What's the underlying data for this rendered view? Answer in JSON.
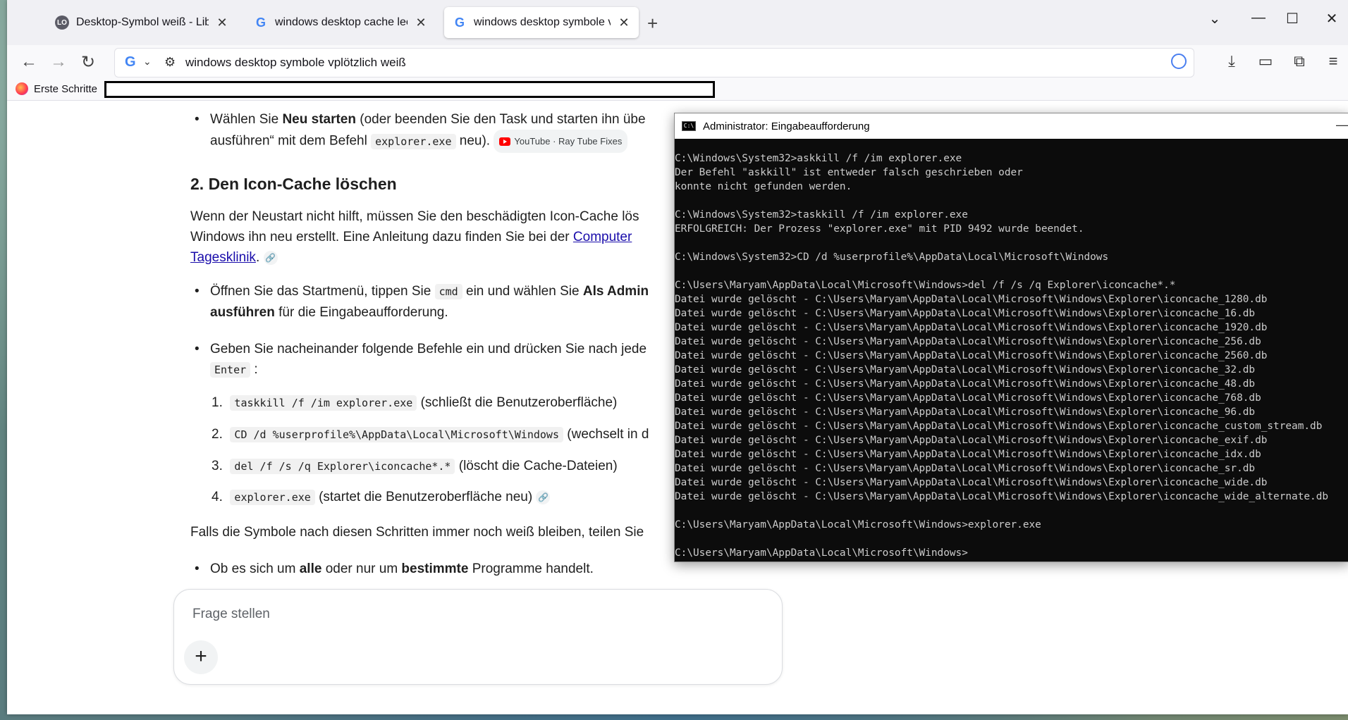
{
  "tabs": [
    {
      "label": "Desktop-Symbol weiß - LibreOf",
      "favicon": "libreoffice-icon"
    },
    {
      "label": "windows desktop cache leeren ·",
      "favicon": "google-icon"
    },
    {
      "label": "windows desktop symbole vplöt",
      "favicon": "google-icon",
      "active": true
    }
  ],
  "address": {
    "url": "windows desktop symbole vplötzlich weiß"
  },
  "bookmarks": {
    "first": "Erste Schritte"
  },
  "article": {
    "b1_pre": "Wählen Sie ",
    "b1_bold": "Neu starten",
    "b1_post": " (oder beenden Sie den Task und starten ihn übe",
    "b1_line2_pre": "ausführen“ mit dem Befehl ",
    "b1_code": "explorer.exe",
    "b1_line2_post": " neu).",
    "chip": "YouTube · Ray Tube Fixes",
    "h2": "2. Den Icon-Cache löschen",
    "p1_l1": "Wenn der Neustart nicht hilft, müssen Sie den beschädigten Icon-Cache lös",
    "p1_l2_pre": "Windows ihn neu erstellt. Eine Anleitung dazu finden Sie bei der ",
    "p1_link1": "Computer",
    "p1_link2": "Tagesklinik",
    "p1_end": ".",
    "b2_pre": "Öffnen Sie das Startmenü, tippen Sie ",
    "b2_code": "cmd",
    "b2_mid": " ein und wählen Sie ",
    "b2_bold1": "Als Admin",
    "b2_bold2": "ausführen",
    "b2_post": " für die Eingabeaufforderung.",
    "b3_l1": "Geben Sie nacheinander folgende Befehle ein und drücken Sie nach jede",
    "b3_code": "Enter",
    "b3_colon": " :",
    "steps": [
      {
        "num": "1.",
        "code": "taskkill /f /im explorer.exe",
        "text": " (schließt die Benutzeroberfläche)"
      },
      {
        "num": "2.",
        "code": "CD /d %userprofile%\\AppData\\Local\\Microsoft\\Windows",
        "text": " (wechselt in d"
      },
      {
        "num": "3.",
        "code": "del /f /s /q Explorer\\iconcache*.*",
        "text": " (löscht die Cache-Dateien)"
      },
      {
        "num": "4.",
        "code": "explorer.exe",
        "text": " (startet die Benutzeroberfläche neu)"
      }
    ],
    "p2": "Falls die Symbole nach diesen Schritten immer noch weiß bleiben, teilen Sie",
    "b4_pre": "Ob es sich um ",
    "b4_bold1": "alle",
    "b4_mid": " oder nur um ",
    "b4_bold2": "bestimmte",
    "b4_post": " Programme handelt."
  },
  "ask": {
    "placeholder": "Frage stellen",
    "plus": "+"
  },
  "cmd": {
    "title": "Administrator: Eingabeaufforderung",
    "lines": [
      "C:\\Windows\\System32>askkill /f /im explorer.exe",
      "Der Befehl \"askkill\" ist entweder falsch geschrieben oder",
      "konnte nicht gefunden werden.",
      "",
      "C:\\Windows\\System32>taskkill /f /im explorer.exe",
      "ERFOLGREICH: Der Prozess \"explorer.exe\" mit PID 9492 wurde beendet.",
      "",
      "C:\\Windows\\System32>CD /d %userprofile%\\AppData\\Local\\Microsoft\\Windows",
      "",
      "C:\\Users\\Maryam\\AppData\\Local\\Microsoft\\Windows>del /f /s /q Explorer\\iconcache*.*",
      "Datei wurde gelöscht - C:\\Users\\Maryam\\AppData\\Local\\Microsoft\\Windows\\Explorer\\iconcache_1280.db",
      "Datei wurde gelöscht - C:\\Users\\Maryam\\AppData\\Local\\Microsoft\\Windows\\Explorer\\iconcache_16.db",
      "Datei wurde gelöscht - C:\\Users\\Maryam\\AppData\\Local\\Microsoft\\Windows\\Explorer\\iconcache_1920.db",
      "Datei wurde gelöscht - C:\\Users\\Maryam\\AppData\\Local\\Microsoft\\Windows\\Explorer\\iconcache_256.db",
      "Datei wurde gelöscht - C:\\Users\\Maryam\\AppData\\Local\\Microsoft\\Windows\\Explorer\\iconcache_2560.db",
      "Datei wurde gelöscht - C:\\Users\\Maryam\\AppData\\Local\\Microsoft\\Windows\\Explorer\\iconcache_32.db",
      "Datei wurde gelöscht - C:\\Users\\Maryam\\AppData\\Local\\Microsoft\\Windows\\Explorer\\iconcache_48.db",
      "Datei wurde gelöscht - C:\\Users\\Maryam\\AppData\\Local\\Microsoft\\Windows\\Explorer\\iconcache_768.db",
      "Datei wurde gelöscht - C:\\Users\\Maryam\\AppData\\Local\\Microsoft\\Windows\\Explorer\\iconcache_96.db",
      "Datei wurde gelöscht - C:\\Users\\Maryam\\AppData\\Local\\Microsoft\\Windows\\Explorer\\iconcache_custom_stream.db",
      "Datei wurde gelöscht - C:\\Users\\Maryam\\AppData\\Local\\Microsoft\\Windows\\Explorer\\iconcache_exif.db",
      "Datei wurde gelöscht - C:\\Users\\Maryam\\AppData\\Local\\Microsoft\\Windows\\Explorer\\iconcache_idx.db",
      "Datei wurde gelöscht - C:\\Users\\Maryam\\AppData\\Local\\Microsoft\\Windows\\Explorer\\iconcache_sr.db",
      "Datei wurde gelöscht - C:\\Users\\Maryam\\AppData\\Local\\Microsoft\\Windows\\Explorer\\iconcache_wide.db",
      "Datei wurde gelöscht - C:\\Users\\Maryam\\AppData\\Local\\Microsoft\\Windows\\Explorer\\iconcache_wide_alternate.db",
      "",
      "C:\\Users\\Maryam\\AppData\\Local\\Microsoft\\Windows>explorer.exe",
      "",
      "C:\\Users\\Maryam\\AppData\\Local\\Microsoft\\Windows>"
    ]
  },
  "colors": {
    "link": "#1a0dab",
    "console_bg": "#0c0c0c",
    "console_fg": "#cccccc"
  }
}
